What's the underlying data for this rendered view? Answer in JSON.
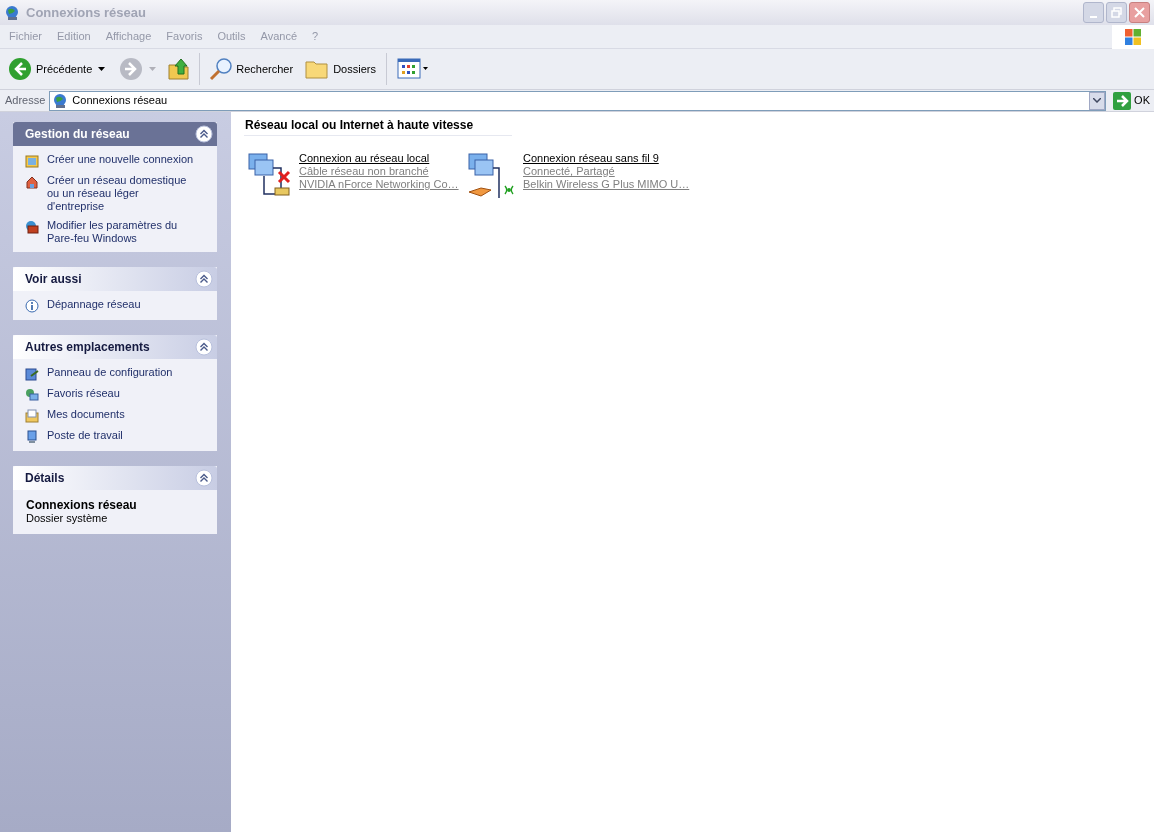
{
  "window": {
    "title": "Connexions réseau",
    "active": false
  },
  "menu": [
    "Fichier",
    "Edition",
    "Affichage",
    "Favoris",
    "Outils",
    "Avancé",
    "?"
  ],
  "toolbar": {
    "back": "Précédente",
    "search": "Rechercher",
    "folders": "Dossiers"
  },
  "address": {
    "label": "Adresse",
    "value": "Connexions réseau",
    "go": "OK"
  },
  "sidebar": [
    {
      "kind": "tasks",
      "title": "Gestion du réseau",
      "expanded": true,
      "items": [
        {
          "label": "Créer une nouvelle connexion"
        },
        {
          "label": "Créer un réseau domestique ou un réseau léger d'entreprise"
        },
        {
          "label": "Modifier les paramètres du Pare-feu Windows"
        }
      ]
    },
    {
      "kind": "links",
      "title": "Voir aussi",
      "expanded": true,
      "items": [
        {
          "label": "Dépannage réseau"
        }
      ]
    },
    {
      "kind": "links",
      "title": "Autres emplacements",
      "expanded": true,
      "items": [
        {
          "label": "Panneau de configuration"
        },
        {
          "label": "Favoris réseau"
        },
        {
          "label": "Mes documents"
        },
        {
          "label": "Poste de travail"
        }
      ]
    },
    {
      "kind": "details",
      "title": "Détails",
      "expanded": true,
      "name": "Connexions réseau",
      "type": "Dossier système"
    }
  ],
  "group": {
    "title": "Réseau local ou Internet à haute vitesse"
  },
  "connections": [
    {
      "kind": "wired",
      "name": "Connexion au réseau local",
      "status": "Câble réseau non branché",
      "device": "NVIDIA nForce Networking Co…"
    },
    {
      "kind": "wireless",
      "name": "Connexion réseau sans fil 9",
      "status": "Connecté, Partagé",
      "device": "Belkin Wireless G Plus MIMO U…"
    }
  ]
}
